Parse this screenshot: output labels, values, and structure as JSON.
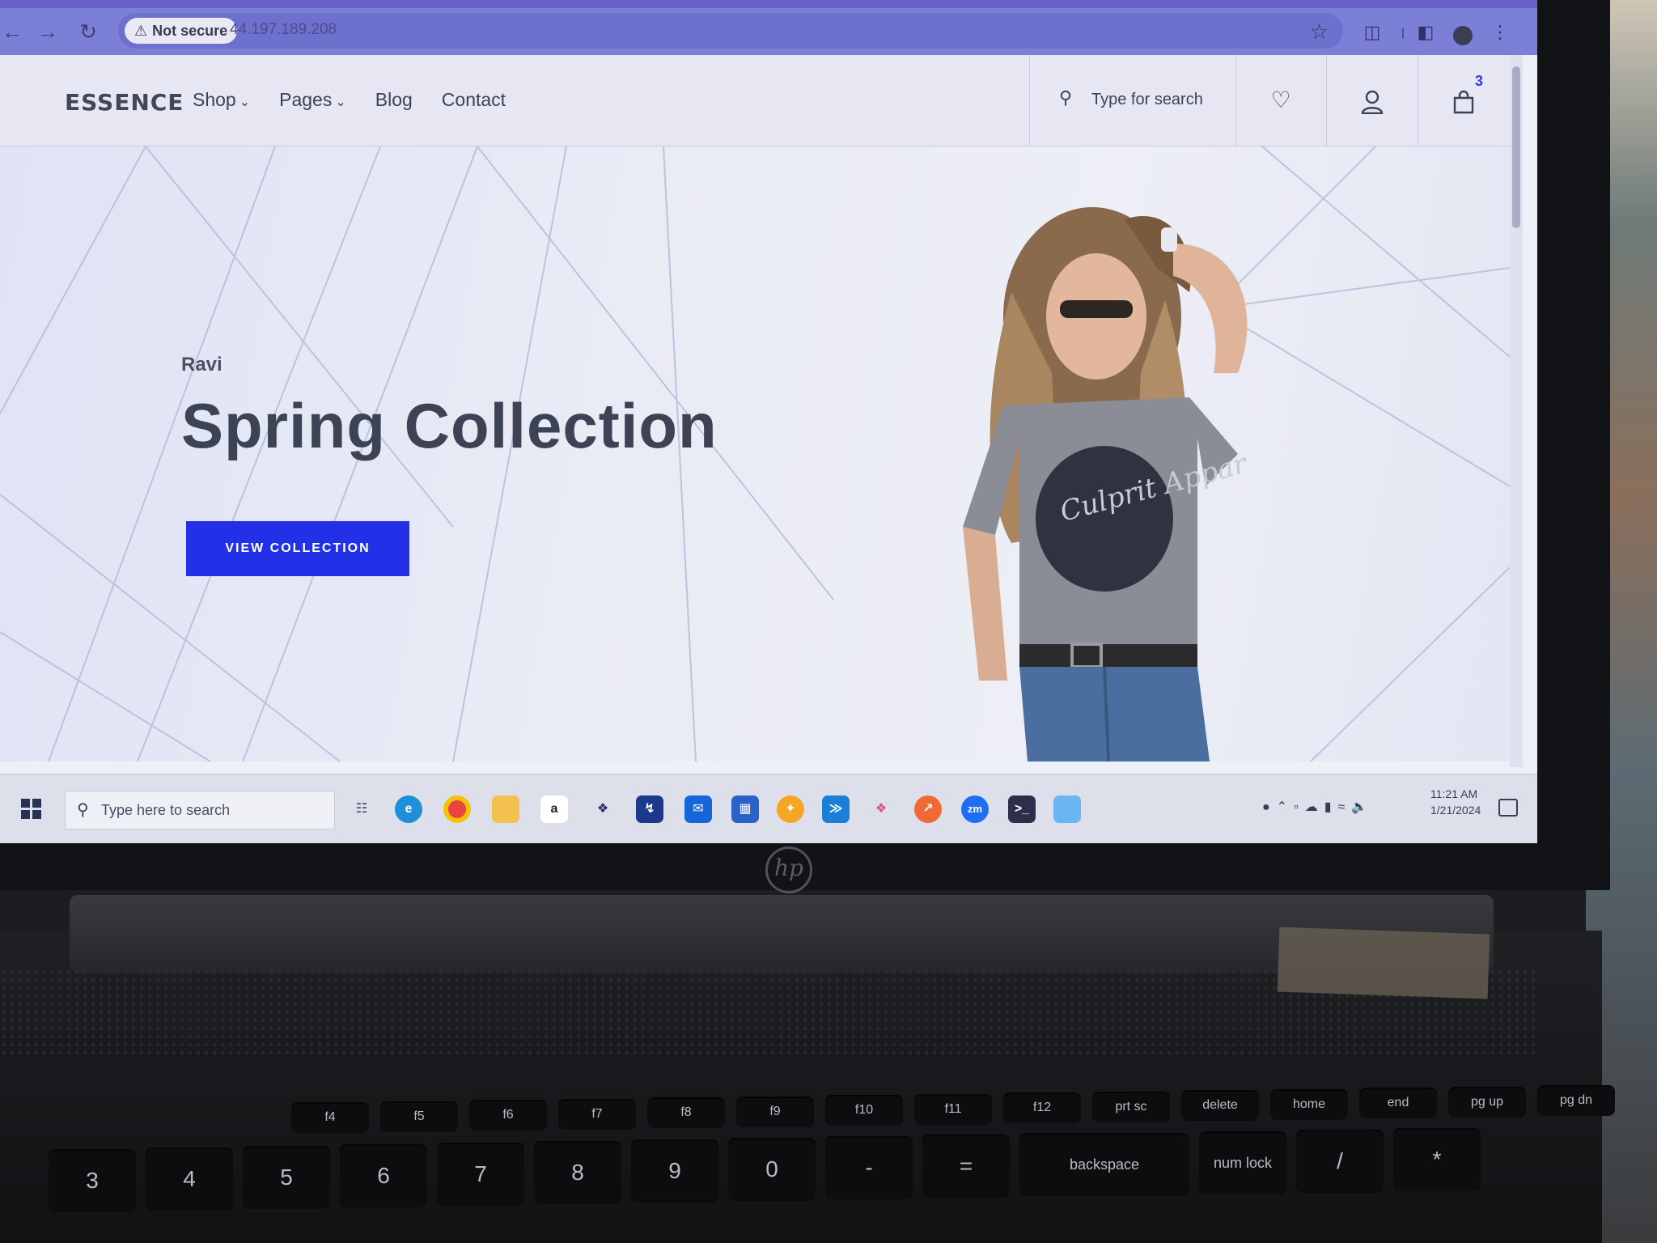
{
  "browser": {
    "security_label": "Not secure",
    "url": "44.197.189.208",
    "icons": [
      "back-arrow-icon",
      "forward-arrow-icon",
      "reload-icon",
      "warning-icon",
      "star-icon",
      "extensions-icon",
      "side-panel-icon",
      "profile-icon",
      "more-icon"
    ]
  },
  "site": {
    "logo": "ESSENCE",
    "menu": [
      {
        "label": "Shop",
        "has_dropdown": true
      },
      {
        "label": "Pages",
        "has_dropdown": true
      },
      {
        "label": "Blog",
        "has_dropdown": false
      },
      {
        "label": "Contact",
        "has_dropdown": false
      }
    ],
    "search_placeholder": "Type for search",
    "cart_count": "3",
    "accent_color": "#2230e8"
  },
  "hero": {
    "kicker": "Ravi",
    "title": "Spring Collection",
    "cta_label": "VIEW COLLECTION",
    "shirt_text": "Culprit Appar"
  },
  "taskbar": {
    "search_placeholder": "Type here to search",
    "apps": [
      "task-view-icon",
      "edge-icon",
      "chrome-icon",
      "file-explorer-icon",
      "amazon-icon",
      "dropbox-icon",
      "app-icon",
      "mail-icon",
      "store-icon",
      "app-icon",
      "vscode-icon",
      "app-icon",
      "app-icon",
      "zoom-icon",
      "terminal-icon",
      "app-icon"
    ],
    "time": "11:21 AM",
    "date": "1/21/2024"
  },
  "keyboard": {
    "fn_row": [
      "f4",
      "f5",
      "f6",
      "f7",
      "f8",
      "f9",
      "f10",
      "f11",
      "f12",
      "prt sc",
      "delete",
      "home",
      "end",
      "pg up",
      "pg dn"
    ],
    "number_row": [
      "3",
      "4",
      "5",
      "6",
      "7",
      "8",
      "9",
      "0",
      "-",
      "=",
      "backspace",
      "num lock",
      "/",
      "*"
    ]
  }
}
